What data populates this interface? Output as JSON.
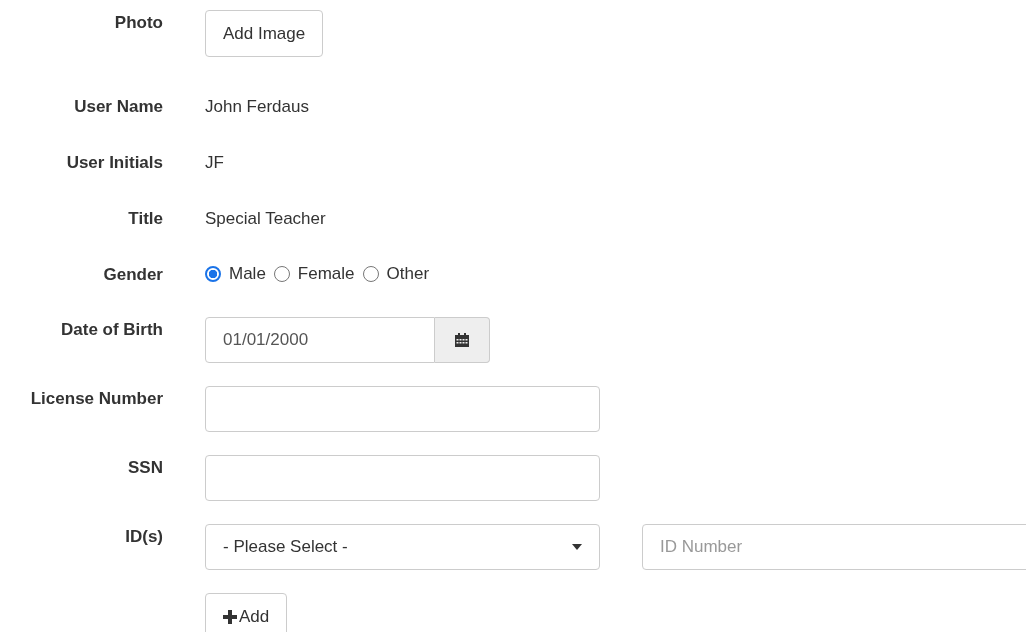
{
  "fields": [
    {
      "label": "Photo",
      "kind": "button",
      "button": "Add Image"
    },
    {
      "label": "User Name",
      "kind": "text",
      "value": "John Ferdaus"
    },
    {
      "label": "User Initials",
      "kind": "text",
      "value": "JF"
    },
    {
      "label": "Title",
      "kind": "text",
      "value": "Special Teacher"
    },
    {
      "label": "Gender",
      "kind": "radio",
      "options": [
        {
          "label": "Male",
          "selected": true
        },
        {
          "label": "Female",
          "selected": false
        },
        {
          "label": "Other",
          "selected": false
        }
      ]
    },
    {
      "label": "Date of Birth",
      "kind": "date",
      "value": "01/01/2000"
    },
    {
      "label": "License Number",
      "kind": "input"
    },
    {
      "label": "SSN",
      "kind": "input"
    },
    {
      "label": "ID(s)",
      "kind": "select",
      "value": "- Please Select -",
      "placeholder": "ID Number"
    }
  ],
  "add_button": "Add"
}
